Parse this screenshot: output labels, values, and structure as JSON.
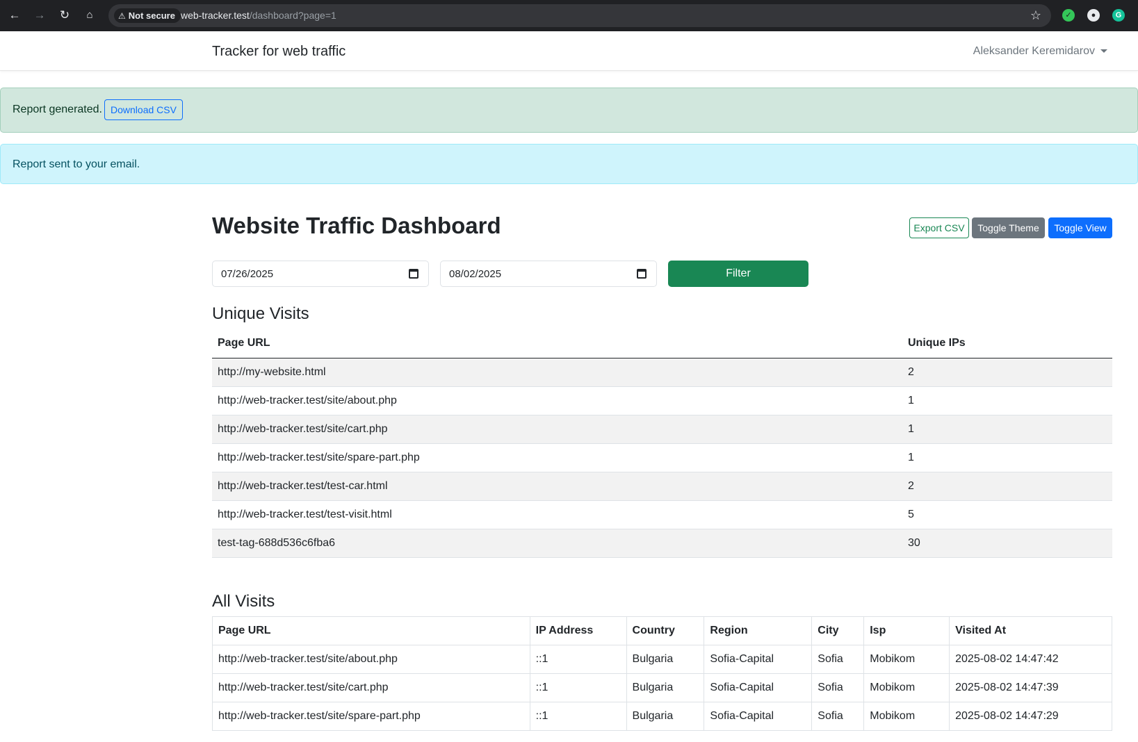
{
  "browser": {
    "security_label": "Not secure",
    "url_host": "web-tracker.test",
    "url_path": "/dashboard?page=1"
  },
  "navbar": {
    "brand": "Tracker for web traffic",
    "user": "Aleksander Keremidarov"
  },
  "alerts": {
    "success_text": "Report generated.",
    "download_label": "Download CSV",
    "info_text": "Report sent to your email."
  },
  "page": {
    "title": "Website Traffic Dashboard",
    "export_label": "Export CSV",
    "theme_label": "Toggle Theme",
    "view_label": "Toggle View",
    "date_from": "07/26/2025",
    "date_to": "08/02/2025",
    "filter_label": "Filter"
  },
  "unique_visits": {
    "title": "Unique Visits",
    "headers": [
      "Page URL",
      "Unique IPs"
    ],
    "rows": [
      [
        "http://my-website.html",
        "2"
      ],
      [
        "http://web-tracker.test/site/about.php",
        "1"
      ],
      [
        "http://web-tracker.test/site/cart.php",
        "1"
      ],
      [
        "http://web-tracker.test/site/spare-part.php",
        "1"
      ],
      [
        "http://web-tracker.test/test-car.html",
        "2"
      ],
      [
        "http://web-tracker.test/test-visit.html",
        "5"
      ],
      [
        "test-tag-688d536c6fba6",
        "30"
      ]
    ]
  },
  "all_visits": {
    "title": "All Visits",
    "headers": [
      "Page URL",
      "IP Address",
      "Country",
      "Region",
      "City",
      "Isp",
      "Visited At"
    ],
    "rows": [
      [
        "http://web-tracker.test/site/about.php",
        "::1",
        "Bulgaria",
        "Sofia-Capital",
        "Sofia",
        "Mobikom",
        "2025-08-02 14:47:42"
      ],
      [
        "http://web-tracker.test/site/cart.php",
        "::1",
        "Bulgaria",
        "Sofia-Capital",
        "Sofia",
        "Mobikom",
        "2025-08-02 14:47:39"
      ],
      [
        "http://web-tracker.test/site/spare-part.php",
        "::1",
        "Bulgaria",
        "Sofia-Capital",
        "Sofia",
        "Mobikom",
        "2025-08-02 14:47:29"
      ]
    ]
  },
  "colors": {
    "success_bg": "#d1e7dd",
    "info_bg": "#cff4fc",
    "primary": "#0d6efd",
    "success": "#198754",
    "secondary": "#6c757d"
  }
}
